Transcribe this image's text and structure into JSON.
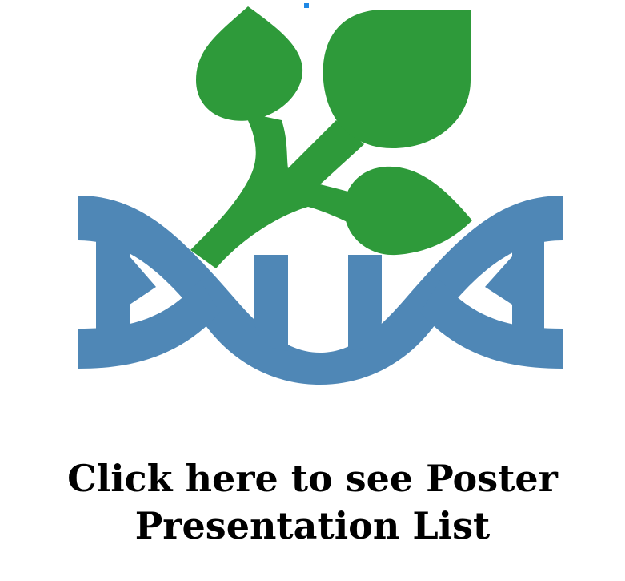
{
  "logo": {
    "icon": "plant-dna-logo-icon",
    "colors": {
      "leaf": "#2e9a3a",
      "helix": "#4f87b6",
      "marker": "#1e88e5",
      "background": "#ffffff"
    }
  },
  "cta": {
    "line1": "Click here to see Poster",
    "line2": "Presentation List",
    "text_color": "#000000"
  }
}
